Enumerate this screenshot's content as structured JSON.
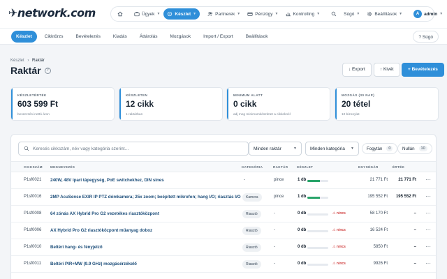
{
  "brand": {
    "logo_text": "network.com"
  },
  "nav": {
    "items": [
      {
        "label": "",
        "icon": "home-icon"
      },
      {
        "label": "Ügyek",
        "icon": "briefcase-icon"
      },
      {
        "label": "Készlet",
        "icon": "box-icon",
        "active": true
      },
      {
        "label": "Partnerek",
        "icon": "users-icon"
      },
      {
        "label": "Pénzügy",
        "icon": "wallet-icon"
      },
      {
        "label": "Kontrolling",
        "icon": "chart-icon"
      },
      {
        "label": "",
        "icon": "search-icon"
      },
      {
        "label": "Súgó",
        "icon": ""
      },
      {
        "label": "Beállítások",
        "icon": "gear-icon"
      }
    ],
    "user_initial": "A",
    "user_name": "admin"
  },
  "tabs": [
    "Készlet",
    "Cikktörzs",
    "Bevételezés",
    "Kiadás",
    "Áttárolás",
    "Mozgások",
    "Import / Export",
    "Beállítások"
  ],
  "help_button": "? Súgó",
  "breadcrumb": {
    "root": "Készlet",
    "sep": "›",
    "current": "Raktár"
  },
  "page_title": "Raktár",
  "actions": {
    "export": "↓ Export",
    "kivet": "↑ Kivét",
    "bevet": "+ Bevételezés"
  },
  "stats": [
    {
      "label": "KÉSZLETÉRTÉK",
      "value": "603 599 Ft",
      "sub": "beszerzési nettó áron"
    },
    {
      "label": "KÉSZLETEN",
      "value": "12 cikk",
      "sub": "1 raktárban"
    },
    {
      "label": "MINIMUM ALATT",
      "value": "0 cikk",
      "sub": "adj meg minimumkészletet a cikkeknél"
    },
    {
      "label": "MOZGÁS (30 NAP)",
      "value": "20 tétel",
      "sub": "10 bizonylat"
    }
  ],
  "filters": {
    "search_placeholder": "Keresés cikkszám, név vagy kategória szerint…",
    "warehouse": "Minden raktár",
    "category": "Minden kategória",
    "chip_fogyo": "Fogytán",
    "chip_fogyo_count": "0",
    "chip_nullan": "Nullán",
    "chip_nullan_count": "10"
  },
  "table": {
    "headers": {
      "sku": "CIKKSZÁM",
      "name": "MEGNEVEZÉS",
      "cat": "KATEGÓRIA",
      "wh": "RAKTÁR",
      "stock": "KÉSZLET",
      "unit": "EGYSÉGÁR",
      "value": "ÉRTÉK"
    },
    "rows": [
      {
        "sku": "P1sf0021",
        "name": "240W, 48V ipari tápegység, PoE switchekhez, DIN sines",
        "cat": "-",
        "wh": "pince",
        "qty": "1 db",
        "level": 0.6,
        "warn": "",
        "unit": "21 771 Ft",
        "value": "21 771 Ft"
      },
      {
        "sku": "P1sf0016",
        "name": "2MP AcuSense EXIR IP PTZ dómkamera; 25x zoom; beépített mikrofon; hang I/O; riasztás I/O",
        "cat": "Kamera",
        "wh": "pince",
        "qty": "1 db",
        "level": 0.6,
        "warn": "",
        "unit": "195 552 Ft",
        "value": "195 552 Ft"
      },
      {
        "sku": "P1sf0008",
        "name": "64 zónás AX Hybrid Pro G2 vezetékes riasztóközpont",
        "cat": "Riasztó",
        "wh": "-",
        "qty": "0 db",
        "level": 0,
        "warn": "nincs",
        "unit": "58 170 Ft",
        "value": "–"
      },
      {
        "sku": "P1sf0006",
        "name": "AX Hybrid Pro G2 riasztóközpont műanyag doboz",
        "cat": "Riasztó",
        "wh": "-",
        "qty": "0 db",
        "level": 0,
        "warn": "nincs",
        "unit": "16 524 Ft",
        "value": "–"
      },
      {
        "sku": "P1sf0010",
        "name": "Beltéri hang- és fényjelző",
        "cat": "Riasztó",
        "wh": "-",
        "qty": "0 db",
        "level": 0,
        "warn": "nincs",
        "unit": "5850 Ft",
        "value": "–"
      },
      {
        "sku": "P1sf0011",
        "name": "Beltéri PIR+MW (9.9 GHz) mozgásérzékelő",
        "cat": "Riasztó",
        "wh": "-",
        "qty": "0 db",
        "level": 0,
        "warn": "nincs",
        "unit": "9926 Ft",
        "value": "–"
      }
    ]
  },
  "colors": {
    "accent": "#2f8fd9",
    "ok": "#2aa56b",
    "danger": "#d14343"
  }
}
